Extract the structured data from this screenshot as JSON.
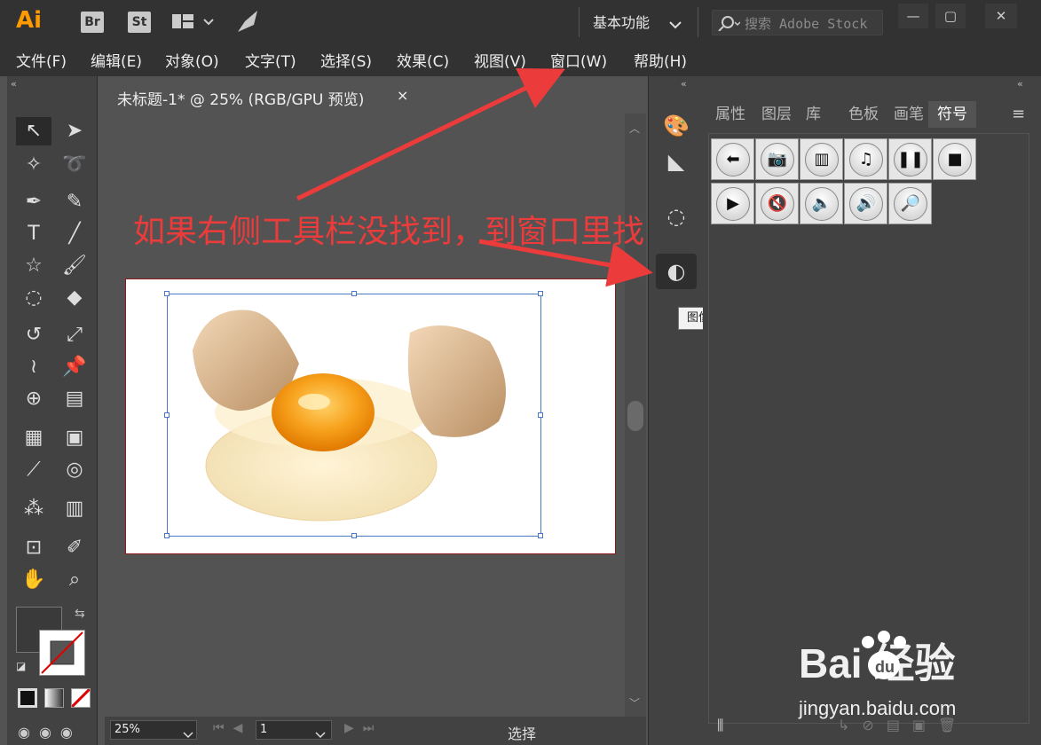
{
  "app": {
    "logo": "Ai",
    "icons": [
      "Br",
      "St"
    ],
    "workspace": "基本功能",
    "search_placeholder": "搜索 Adobe Stock",
    "window_buttons": [
      "—",
      "▢",
      "✕"
    ]
  },
  "menubar": {
    "items": [
      "文件(F)",
      "编辑(E)",
      "对象(O)",
      "文字(T)",
      "选择(S)",
      "效果(C)",
      "视图(V)",
      "窗口(W)",
      "帮助(H)"
    ]
  },
  "document": {
    "tab_title": "未标题-1* @ 25% (RGB/GPU 预览)",
    "close": "×"
  },
  "status": {
    "zoom": "25%",
    "page": "1",
    "mode": "选择"
  },
  "dock": {
    "tooltip": "图像描摹"
  },
  "panel": {
    "tabs": [
      "属性",
      "图层",
      "库",
      "色板",
      "画笔",
      "符号"
    ],
    "active_tab": "符号",
    "symbols": [
      "arrow-left",
      "camera",
      "film",
      "music",
      "pause",
      "stop",
      "play",
      "mute",
      "volume-low",
      "volume-high",
      "magnifier"
    ]
  },
  "annotation": {
    "text": "如果右侧工具栏没找到，到窗口里找",
    "color": "#ec3b3b"
  },
  "watermark": {
    "brand": "Bai  经验",
    "url": "jingyan.baidu.com"
  },
  "colors": {
    "accent": "#ff9a00",
    "ui_dark": "#323232",
    "ui_mid": "#424242",
    "canvas": "#535353"
  }
}
